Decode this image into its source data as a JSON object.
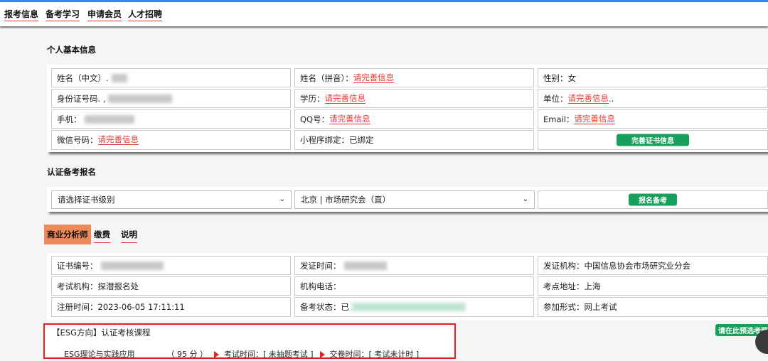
{
  "nav": [
    {
      "label": "报考信息"
    },
    {
      "label": "备考学习"
    },
    {
      "label": "申请会员"
    },
    {
      "label": "人才招聘"
    }
  ],
  "personal": {
    "title": "个人基本信息",
    "name_cn_label": "姓名（中文）.",
    "name_pinyin_label": "姓名（拼音）：",
    "name_pinyin_value": "请完善信息",
    "gender_label": "性别：",
    "gender_value": "女",
    "id_label": "身份证号码. ,",
    "education_label": "学历：",
    "education_value": "请完善信息",
    "unit_label": "单位：",
    "unit_value": "请完善信息",
    "unit_suffix": "..",
    "phone_label": "手机：",
    "qq_label": "QQ号：",
    "qq_value": "请完善信息",
    "email_label": "Email：",
    "email_value": "请完善信息",
    "wechat_label": "微信号码：",
    "wechat_value": "请完善信息",
    "miniapp_label": "小程序绑定：",
    "miniapp_value": "已绑定",
    "complete_cert_button": "完善证书信息"
  },
  "signup": {
    "title": "认证备考报名",
    "level_select": "请选择证书级别",
    "city_select": "北京 | 市场研究会（直）",
    "register_button": "报名备考"
  },
  "tabs": [
    {
      "label": "商业分析师"
    },
    {
      "label": "缴费"
    },
    {
      "label": "说明"
    }
  ],
  "cert": {
    "cert_no_label": "证书编号：",
    "issue_time_label": "发证时间：",
    "issuer_label": "发证机构：",
    "issuer_value": "中国信息协会市场研究业分会",
    "exam_org_label": "考试机构：",
    "exam_org_value": "探潜报名处",
    "org_phone_label": "机构电话：",
    "exam_site_label": "考点地址：",
    "exam_site_value": "上海",
    "reg_time_label": "注册时间：",
    "reg_time_value": "2023-06-05 17:11:11",
    "prep_status_label": "备考状态：",
    "prep_status_value": "已",
    "format_label": "参加形式：",
    "format_value": "网上考试"
  },
  "esg": {
    "heading": "【ESG方向】认证考核课程",
    "course": "ESG理论与实践应用",
    "score": "（ 95 分 ）",
    "exam_time": "考试时间：[ 未抽题考试 ]",
    "submit_time": "交卷时间：[ 考试未计时 ]",
    "preselect_button": "请在此预选考耶"
  },
  "colors": {
    "accent_red": "#e53935",
    "green": "#16a05b",
    "tab_orange": "#ee8a5a"
  }
}
